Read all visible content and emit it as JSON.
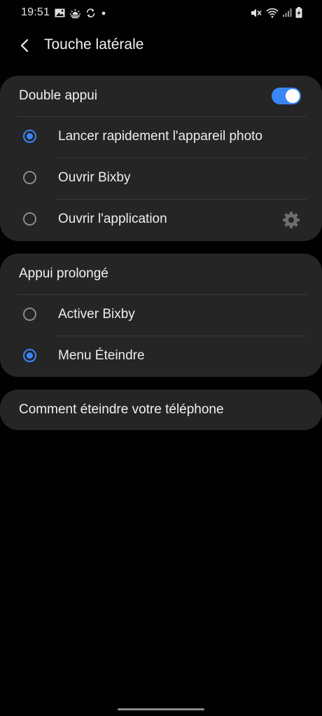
{
  "status_bar": {
    "time": "19:51",
    "left_icons": [
      "gallery-icon",
      "weather-icon",
      "sync-icon",
      "dot-icon"
    ],
    "right_icons": [
      "mute-icon",
      "wifi-icon",
      "signal-icon",
      "battery-charging-icon"
    ]
  },
  "header": {
    "title": "Touche latérale"
  },
  "double_press": {
    "title": "Double appui",
    "enabled": true,
    "options": [
      {
        "label": "Lancer rapidement l'appareil photo",
        "selected": true
      },
      {
        "label": "Ouvrir Bixby",
        "selected": false
      },
      {
        "label": "Ouvrir l'application",
        "selected": false,
        "has_settings": true
      }
    ]
  },
  "long_press": {
    "title": "Appui prolongé",
    "options": [
      {
        "label": "Activer Bixby",
        "selected": false
      },
      {
        "label": "Menu Éteindre",
        "selected": true
      }
    ]
  },
  "how_to": {
    "label": "Comment éteindre votre téléphone"
  },
  "colors": {
    "accent": "#3a86f5",
    "card": "#252525",
    "background": "#010101"
  }
}
